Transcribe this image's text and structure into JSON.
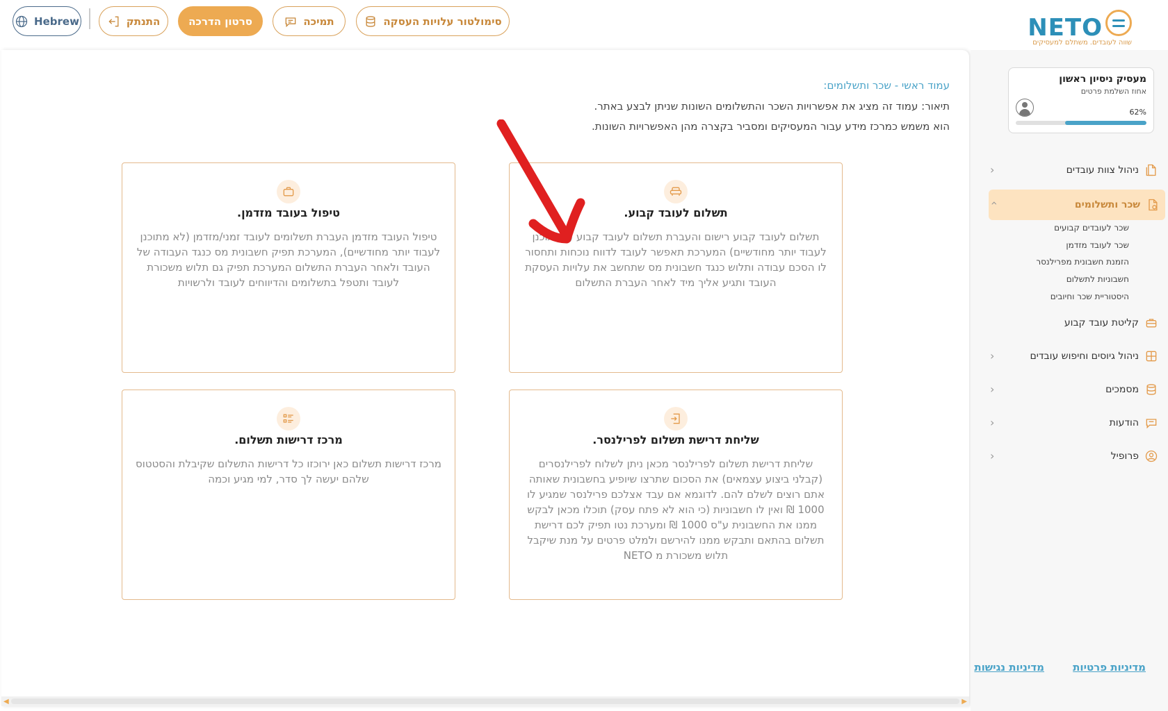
{
  "topbar": {
    "language_label": "Hebrew",
    "logout_label": "התנתק",
    "guide_label": "סרטון הדרכה",
    "support_label": "תמיכה",
    "simulator_label": "סימולטור עלויות העסקה"
  },
  "logo": {
    "name": "NETO",
    "tagline": "שווה לעובדים. משתלם למעסיקים"
  },
  "main": {
    "breadcrumb": "עמוד ראשי - שכר ותשלומים:",
    "description_line1": "תיאור: עמוד זה מציג את אפשרויות השכר והתשלומים השונות שניתן לבצע באתר.",
    "description_line2": "הוא משמש כמרכז מידע עבור המעסיקים ומסביר בקצרה מהן האפשרויות השונות.",
    "cards": [
      {
        "title": "תשלום לעובד קבוע.",
        "text": "תשלום לעובד קבוע רישום והעברת תשלום לעובד קבוע (שמתוכנן לעבוד יותר מחודשיים) המערכת תאפשר לעובד לדווח נוכחות ותחסור לו הסכם עבודה ותלוש כנגד חשבונית מס שתחשב את עלויות העסקת העובד ותגיע אליך מיד לאחר העברת התשלום",
        "icon": "sofa-icon"
      },
      {
        "title": "טיפול בעובד מזדמן.",
        "text": "טיפול העובד מזדמן העברת תשלומים לעובד זמני/מזדמן (לא מתוכנן לעבוד יותר מחודשיים), המערכת תפיק חשבונית מס כנגד העבודה של העובד ולאחר העברת התשלום המערכת תפיק גם תלוש משכורת לעובד ותטפל בתשלומים והדיווחים לעובד ולרשויות",
        "icon": "briefcase-icon"
      },
      {
        "title": "שליחת דרישת תשלום לפרילנסר.",
        "text": "שליחת דרישת תשלום לפרילנסר מכאן ניתן לשלוח לפרילנסרים (קבלני ביצוע עצמאים) את הסכום שתרצו שיופיע בחשבונית שאותה אתם רוצים לשלם להם. לדוגמא אם עבד אצלכם פרילנסר שמגיע לו 1000 ₪ ואין לו חשבוניות (כי הוא לא פתח עסק) תוכלו מכאן לבקש ממנו את החשבונית ע\"ס 1000 ₪ ומערכת נטו תפיק לכם דרישת תשלום בהתאם ותבקש ממנו להירשם ולמלט פרטים על מנת שיקבל תלוש משכורת מ NETO",
        "icon": "export-icon"
      },
      {
        "title": "מרכז דרישות תשלום.",
        "text": "מרכז דרישות תשלום כאן ירוכזו כל דרישות התשלום שקיבלת והסטטוס שלהם יעשה לך סדר, למי מגיע וכמה",
        "icon": "list-icon"
      }
    ]
  },
  "sidebar": {
    "profile_name": "מעסיק ניסיון ראשון",
    "profile_sub": "אחוז השלמת פרטים",
    "profile_percent_label": "62%",
    "profile_percent": 0.62,
    "nav": [
      {
        "label": "ניהול צוות עובדים"
      },
      {
        "label": "שכר ותשלומים"
      },
      {
        "label": "קליטת עובד קבוע"
      },
      {
        "label": "ניהול גיוסים וחיפוש עובדים"
      },
      {
        "label": "מסמכים"
      },
      {
        "label": "הודעות"
      },
      {
        "label": "פרופיל"
      }
    ],
    "sub_items": [
      {
        "label": "שכר לעובדים קבועים"
      },
      {
        "label": "שכר לעובד מזדמן"
      },
      {
        "label": "הזמנת חשבונית מפרילנסר"
      },
      {
        "label": "חשבוניות לתשלום"
      },
      {
        "label": "היסטוריית שכר וחיובים"
      }
    ],
    "footer": {
      "privacy": "מדיניות פרטיות",
      "accessibility": "מדיניות נגישות"
    }
  },
  "colors": {
    "accent": "#edaa52",
    "brand_blue": "#2c8fb8",
    "link": "#4aa3c8",
    "card_border": "#e3b98c",
    "arrow": "#e02020"
  }
}
